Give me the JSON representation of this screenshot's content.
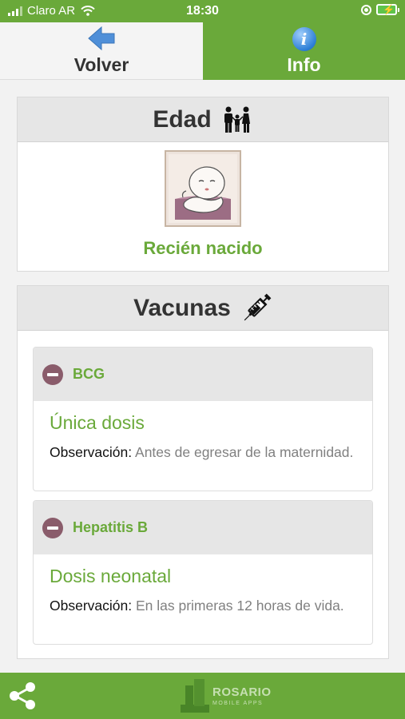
{
  "status_bar": {
    "carrier": "Claro AR",
    "time": "18:30"
  },
  "nav": {
    "back_label": "Volver",
    "info_label": "Info",
    "info_icon_glyph": "i"
  },
  "edad": {
    "title": "Edad",
    "age_label": "Recién nacido"
  },
  "vacunas": {
    "title": "Vacunas",
    "items": [
      {
        "name": "BCG",
        "dose": "Única dosis",
        "observation_label": "Observación:",
        "observation": "Antes de egresar de la maternidad."
      },
      {
        "name": "Hepatitis B",
        "dose": "Dosis neonatal",
        "observation_label": "Observación:",
        "observation": "En las primeras 12 horas de vida."
      }
    ]
  },
  "bottom_bar": {
    "brand_name": "ROSARIO",
    "brand_sub": "MOBILE APPS"
  },
  "colors": {
    "brand_green": "#6aa93a",
    "header_gray": "#e6e6e6",
    "collapse_icon": "#8a5c6b",
    "back_arrow": "#4f8fd8"
  },
  "icons": {
    "back": "left-arrow-icon",
    "info": "info-icon",
    "edad": "family-icon",
    "vacunas": "syringe-icon",
    "collapse": "minus-circle-icon",
    "share": "share-icon"
  }
}
